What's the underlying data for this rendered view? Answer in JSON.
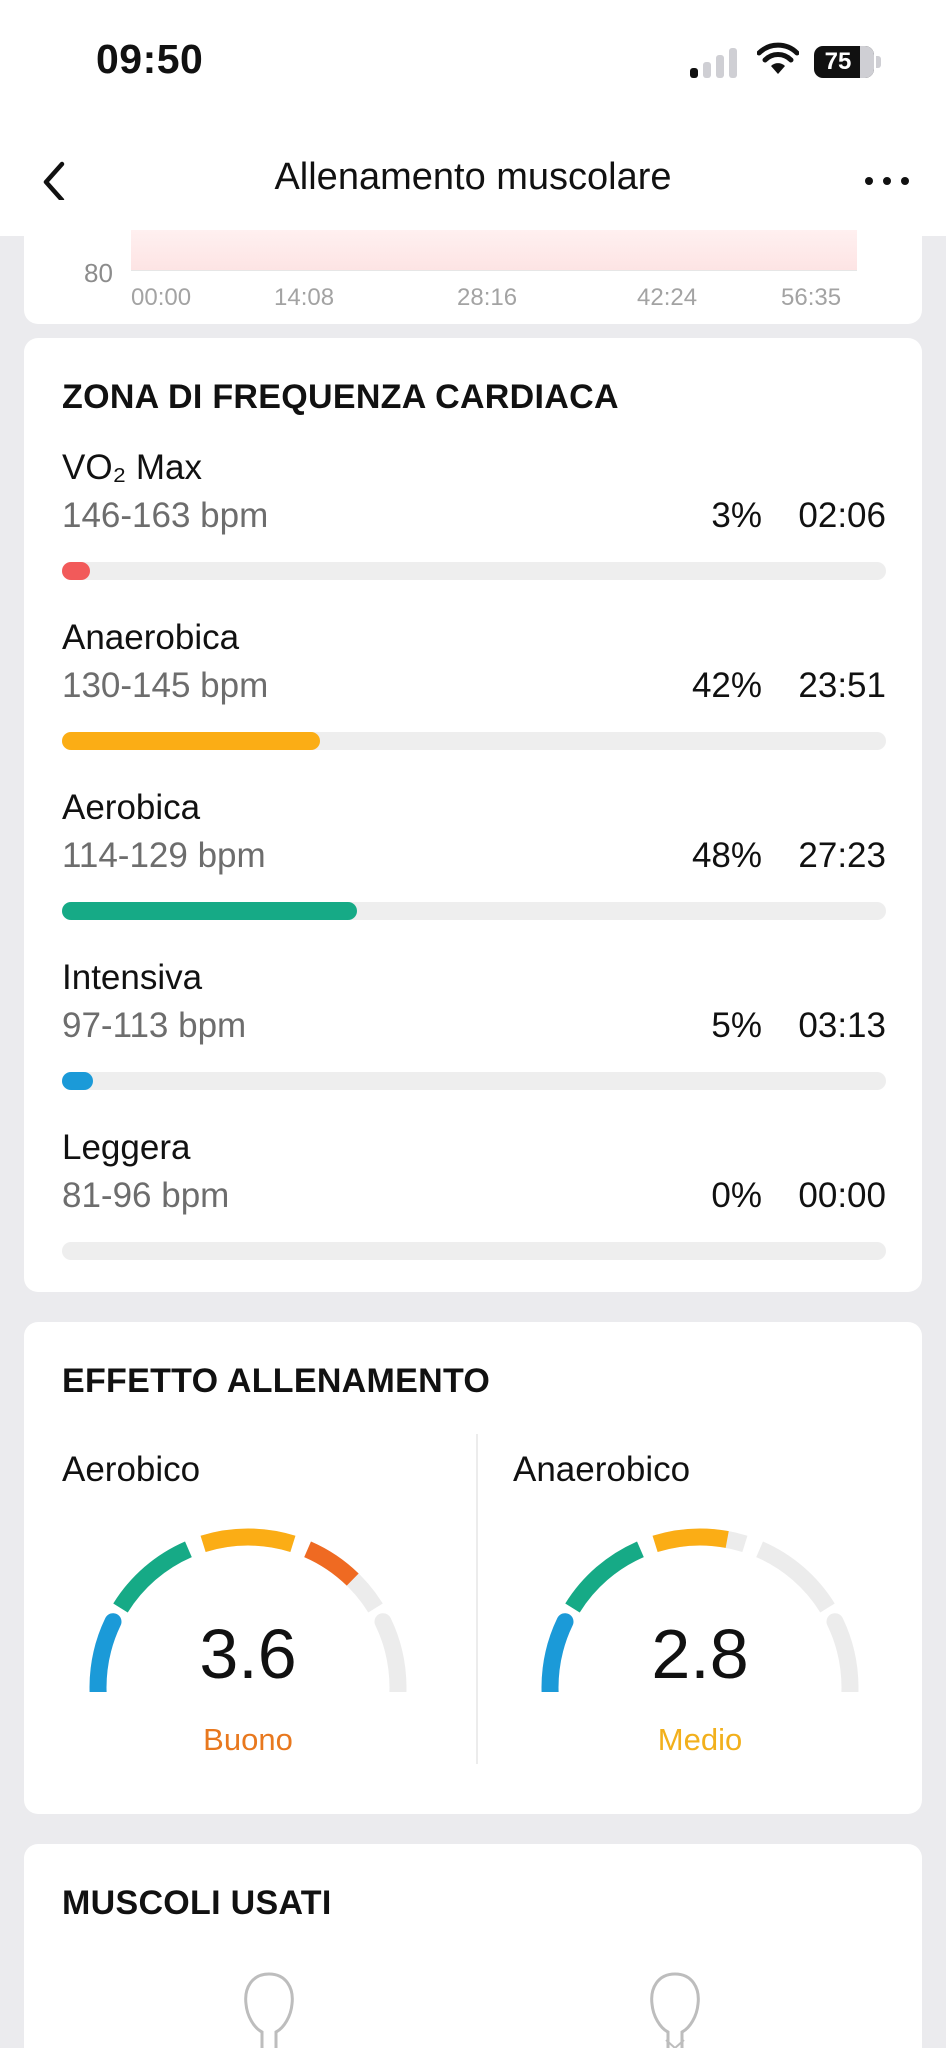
{
  "status": {
    "time": "09:50",
    "battery": "75"
  },
  "nav": {
    "title": "Allenamento muscolare"
  },
  "hr_chart": {
    "y_tick": "80",
    "x_ticks": [
      "00:00",
      "14:08",
      "28:16",
      "42:24",
      "56:35"
    ]
  },
  "hr_zones": {
    "title": "ZONA DI FREQUENZA CARDIACA",
    "zones": [
      {
        "name": "VO₂ Max",
        "range": "146-163 bpm",
        "percent": "3%",
        "time": "02:06",
        "fraction": 0.03,
        "color": "#f25a5a"
      },
      {
        "name": "Anaerobica",
        "range": "130-145 bpm",
        "percent": "42%",
        "time": "23:51",
        "fraction": 0.42,
        "color": "#fbad15"
      },
      {
        "name": "Aerobica",
        "range": "114-129 bpm",
        "percent": "48%",
        "time": "27:23",
        "fraction": 0.48,
        "color": "#16aa86"
      },
      {
        "name": "Intensiva",
        "range": "97-113 bpm",
        "percent": "5%",
        "time": "03:13",
        "fraction": 0.05,
        "color": "#1b9ad8"
      },
      {
        "name": "Leggera",
        "range": "81-96 bpm",
        "percent": "0%",
        "time": "00:00",
        "fraction": 0.0,
        "color": "#cccccc"
      }
    ]
  },
  "training_effect": {
    "title": "EFFETTO ALLENAMENTO",
    "aerobic": {
      "label": "Aerobico",
      "value": "3.6",
      "rating": "Buono",
      "rating_color": "#e8781e"
    },
    "anaerobic": {
      "label": "Anaerobico",
      "value": "2.8",
      "rating": "Medio",
      "rating_color": "#f2b01c"
    }
  },
  "muscles": {
    "title": "MUSCOLI USATI"
  },
  "colors": {
    "gauge_blue": "#1b9ad8",
    "gauge_green": "#16aa86",
    "gauge_yellow": "#fbad15",
    "gauge_orange": "#ef6a22",
    "gauge_track": "#ececec"
  }
}
